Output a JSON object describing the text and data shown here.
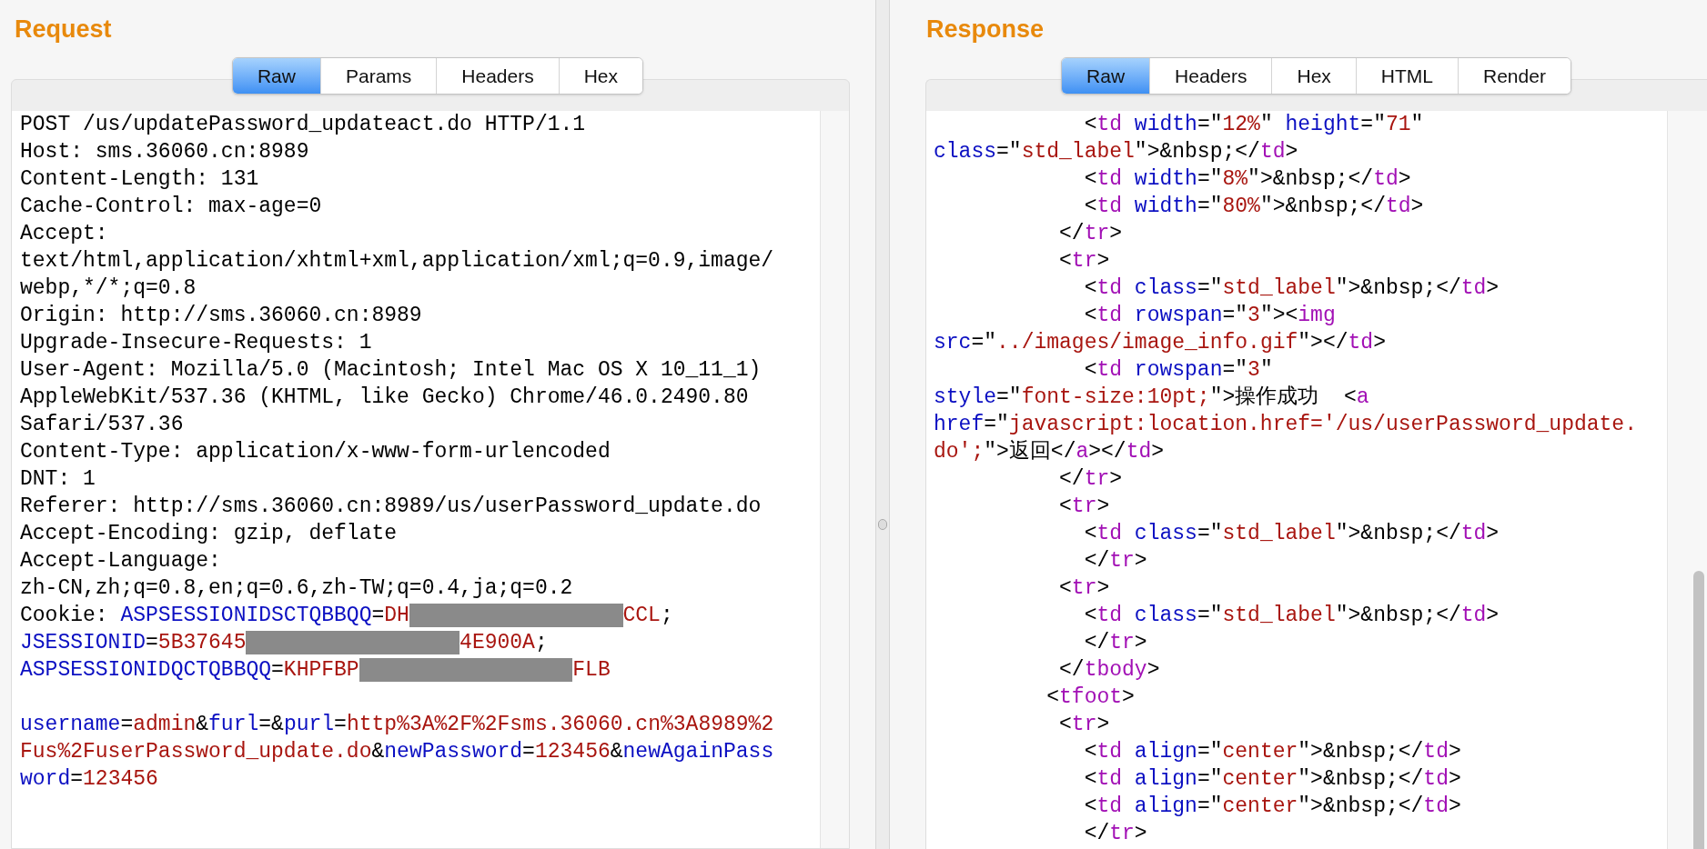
{
  "request": {
    "title": "Request",
    "tabs": [
      {
        "label": "Raw",
        "selected": true
      },
      {
        "label": "Params",
        "selected": false
      },
      {
        "label": "Headers",
        "selected": false
      },
      {
        "label": "Hex",
        "selected": false
      }
    ],
    "headers": [
      [
        {
          "kind": "plain",
          "text": "POST /us/updatePassword_updateact.do HTTP/1.1"
        }
      ],
      [
        {
          "kind": "plain",
          "text": "Host: sms.36060.cn:8989"
        }
      ],
      [
        {
          "kind": "plain",
          "text": "Content-Length: 131"
        }
      ],
      [
        {
          "kind": "plain",
          "text": "Cache-Control: max-age=0"
        }
      ],
      [
        {
          "kind": "plain",
          "text": "Accept:"
        }
      ],
      [
        {
          "kind": "plain",
          "text": "text/html,application/xhtml+xml,application/xml;q=0.9,image/"
        }
      ],
      [
        {
          "kind": "plain",
          "text": "webp,*/*;q=0.8"
        }
      ],
      [
        {
          "kind": "plain",
          "text": "Origin: http://sms.36060.cn:8989"
        }
      ],
      [
        {
          "kind": "plain",
          "text": "Upgrade-Insecure-Requests: 1"
        }
      ],
      [
        {
          "kind": "plain",
          "text": "User-Agent: Mozilla/5.0 (Macintosh; Intel Mac OS X 10_11_1)"
        }
      ],
      [
        {
          "kind": "plain",
          "text": "AppleWebKit/537.36 (KHTML, like Gecko) Chrome/46.0.2490.80"
        }
      ],
      [
        {
          "kind": "plain",
          "text": "Safari/537.36"
        }
      ],
      [
        {
          "kind": "plain",
          "text": "Content-Type: application/x-www-form-urlencoded"
        }
      ],
      [
        {
          "kind": "plain",
          "text": "DNT: 1"
        }
      ],
      [
        {
          "kind": "plain",
          "text": "Referer: http://sms.36060.cn:8989/us/userPassword_update.do"
        }
      ],
      [
        {
          "kind": "plain",
          "text": "Accept-Encoding: gzip, deflate"
        }
      ],
      [
        {
          "kind": "plain",
          "text": "Accept-Language:"
        }
      ],
      [
        {
          "kind": "plain",
          "text": "zh-CN,zh;q=0.8,en;q=0.6,zh-TW;q=0.4,ja;q=0.2"
        }
      ],
      [
        {
          "kind": "plain",
          "text": "Cookie: "
        },
        {
          "kind": "name",
          "text": "ASPSESSIONIDSCTQBBQQ"
        },
        {
          "kind": "plain",
          "text": "="
        },
        {
          "kind": "value",
          "text": "DH"
        },
        {
          "kind": "redacted"
        },
        {
          "kind": "value",
          "text": "CCL"
        },
        {
          "kind": "plain",
          "text": ";"
        }
      ],
      [
        {
          "kind": "name",
          "text": "JSESSIONID"
        },
        {
          "kind": "plain",
          "text": "="
        },
        {
          "kind": "value",
          "text": "5B37645"
        },
        {
          "kind": "redacted"
        },
        {
          "kind": "value",
          "text": "4E900A"
        },
        {
          "kind": "plain",
          "text": ";"
        }
      ],
      [
        {
          "kind": "name",
          "text": "ASPSESSIONIDQCTQBBQQ"
        },
        {
          "kind": "plain",
          "text": "="
        },
        {
          "kind": "value",
          "text": "KHPFBP"
        },
        {
          "kind": "redacted"
        },
        {
          "kind": "value",
          "text": "FLB"
        }
      ]
    ],
    "body": [
      [
        {
          "kind": "name",
          "text": "username"
        },
        {
          "kind": "plain",
          "text": "="
        },
        {
          "kind": "value",
          "text": "admin"
        },
        {
          "kind": "plain",
          "text": "&"
        },
        {
          "kind": "name",
          "text": "furl"
        },
        {
          "kind": "plain",
          "text": "=&"
        },
        {
          "kind": "name",
          "text": "purl"
        },
        {
          "kind": "plain",
          "text": "="
        },
        {
          "kind": "value",
          "text": "http%3A%2F%2Fsms.36060.cn%3A8989%2"
        }
      ],
      [
        {
          "kind": "value",
          "text": "Fus%2FuserPassword_update.do"
        },
        {
          "kind": "plain",
          "text": "&"
        },
        {
          "kind": "name",
          "text": "newPassword"
        },
        {
          "kind": "plain",
          "text": "="
        },
        {
          "kind": "value",
          "text": "123456"
        },
        {
          "kind": "plain",
          "text": "&"
        },
        {
          "kind": "name",
          "text": "newAgainPass"
        }
      ],
      [
        {
          "kind": "name",
          "text": "word"
        },
        {
          "kind": "plain",
          "text": "="
        },
        {
          "kind": "value",
          "text": "123456"
        }
      ]
    ]
  },
  "response": {
    "title": "Response",
    "tabs": [
      {
        "label": "Raw",
        "selected": true
      },
      {
        "label": "Headers",
        "selected": false
      },
      {
        "label": "Hex",
        "selected": false
      },
      {
        "label": "HTML",
        "selected": false
      },
      {
        "label": "Render",
        "selected": false
      }
    ],
    "lines": [
      [
        {
          "kind": "plain",
          "text": "            <"
        },
        {
          "kind": "tag",
          "text": "td"
        },
        {
          "kind": "name",
          "text": " width"
        },
        {
          "kind": "plain",
          "text": "=\""
        },
        {
          "kind": "value",
          "text": "12%"
        },
        {
          "kind": "plain",
          "text": "\" "
        },
        {
          "kind": "name",
          "text": "height"
        },
        {
          "kind": "plain",
          "text": "=\""
        },
        {
          "kind": "value",
          "text": "71"
        },
        {
          "kind": "plain",
          "text": "\""
        }
      ],
      [
        {
          "kind": "name",
          "text": "class"
        },
        {
          "kind": "plain",
          "text": "=\""
        },
        {
          "kind": "value",
          "text": "std_label"
        },
        {
          "kind": "plain",
          "text": "\">&nbsp;</"
        },
        {
          "kind": "tag",
          "text": "td"
        },
        {
          "kind": "plain",
          "text": ">"
        }
      ],
      [
        {
          "kind": "plain",
          "text": "            <"
        },
        {
          "kind": "tag",
          "text": "td"
        },
        {
          "kind": "name",
          "text": " width"
        },
        {
          "kind": "plain",
          "text": "=\""
        },
        {
          "kind": "value",
          "text": "8%"
        },
        {
          "kind": "plain",
          "text": "\">&nbsp;</"
        },
        {
          "kind": "tag",
          "text": "td"
        },
        {
          "kind": "plain",
          "text": ">"
        }
      ],
      [
        {
          "kind": "plain",
          "text": "            <"
        },
        {
          "kind": "tag",
          "text": "td"
        },
        {
          "kind": "name",
          "text": " width"
        },
        {
          "kind": "plain",
          "text": "=\""
        },
        {
          "kind": "value",
          "text": "80%"
        },
        {
          "kind": "plain",
          "text": "\">&nbsp;</"
        },
        {
          "kind": "tag",
          "text": "td"
        },
        {
          "kind": "plain",
          "text": ">"
        }
      ],
      [
        {
          "kind": "plain",
          "text": "          </"
        },
        {
          "kind": "tag",
          "text": "tr"
        },
        {
          "kind": "plain",
          "text": ">"
        }
      ],
      [
        {
          "kind": "plain",
          "text": "          <"
        },
        {
          "kind": "tag",
          "text": "tr"
        },
        {
          "kind": "plain",
          "text": ">"
        }
      ],
      [
        {
          "kind": "plain",
          "text": "            <"
        },
        {
          "kind": "tag",
          "text": "td"
        },
        {
          "kind": "name",
          "text": " class"
        },
        {
          "kind": "plain",
          "text": "=\""
        },
        {
          "kind": "value",
          "text": "std_label"
        },
        {
          "kind": "plain",
          "text": "\">&nbsp;</"
        },
        {
          "kind": "tag",
          "text": "td"
        },
        {
          "kind": "plain",
          "text": ">"
        }
      ],
      [
        {
          "kind": "plain",
          "text": "            <"
        },
        {
          "kind": "tag",
          "text": "td"
        },
        {
          "kind": "name",
          "text": " rowspan"
        },
        {
          "kind": "plain",
          "text": "=\""
        },
        {
          "kind": "value",
          "text": "3"
        },
        {
          "kind": "plain",
          "text": "\"><"
        },
        {
          "kind": "tag",
          "text": "img"
        }
      ],
      [
        {
          "kind": "name",
          "text": "src"
        },
        {
          "kind": "plain",
          "text": "=\""
        },
        {
          "kind": "value",
          "text": "../images/image_info.gif"
        },
        {
          "kind": "plain",
          "text": "\"></"
        },
        {
          "kind": "tag",
          "text": "td"
        },
        {
          "kind": "plain",
          "text": ">"
        }
      ],
      [
        {
          "kind": "plain",
          "text": "            <"
        },
        {
          "kind": "tag",
          "text": "td"
        },
        {
          "kind": "name",
          "text": " rowspan"
        },
        {
          "kind": "plain",
          "text": "=\""
        },
        {
          "kind": "value",
          "text": "3"
        },
        {
          "kind": "plain",
          "text": "\""
        }
      ],
      [
        {
          "kind": "name",
          "text": "style"
        },
        {
          "kind": "plain",
          "text": "=\""
        },
        {
          "kind": "value",
          "text": "font-size:10pt;"
        },
        {
          "kind": "plain",
          "text": "\">操作成功  <"
        },
        {
          "kind": "tag",
          "text": "a"
        }
      ],
      [
        {
          "kind": "name",
          "text": "href"
        },
        {
          "kind": "plain",
          "text": "=\""
        },
        {
          "kind": "value",
          "text": "javascript:location.href='/us/userPassword_update."
        }
      ],
      [
        {
          "kind": "value",
          "text": "do';"
        },
        {
          "kind": "plain",
          "text": "\">返回</"
        },
        {
          "kind": "tag",
          "text": "a"
        },
        {
          "kind": "plain",
          "text": "></"
        },
        {
          "kind": "tag",
          "text": "td"
        },
        {
          "kind": "plain",
          "text": ">"
        }
      ],
      [
        {
          "kind": "plain",
          "text": "          </"
        },
        {
          "kind": "tag",
          "text": "tr"
        },
        {
          "kind": "plain",
          "text": ">"
        }
      ],
      [
        {
          "kind": "plain",
          "text": "          <"
        },
        {
          "kind": "tag",
          "text": "tr"
        },
        {
          "kind": "plain",
          "text": ">"
        }
      ],
      [
        {
          "kind": "plain",
          "text": "            <"
        },
        {
          "kind": "tag",
          "text": "td"
        },
        {
          "kind": "name",
          "text": " class"
        },
        {
          "kind": "plain",
          "text": "=\""
        },
        {
          "kind": "value",
          "text": "std_label"
        },
        {
          "kind": "plain",
          "text": "\">&nbsp;</"
        },
        {
          "kind": "tag",
          "text": "td"
        },
        {
          "kind": "plain",
          "text": ">"
        }
      ],
      [
        {
          "kind": "plain",
          "text": "            </"
        },
        {
          "kind": "tag",
          "text": "tr"
        },
        {
          "kind": "plain",
          "text": ">"
        }
      ],
      [
        {
          "kind": "plain",
          "text": "          <"
        },
        {
          "kind": "tag",
          "text": "tr"
        },
        {
          "kind": "plain",
          "text": ">"
        }
      ],
      [
        {
          "kind": "plain",
          "text": "            <"
        },
        {
          "kind": "tag",
          "text": "td"
        },
        {
          "kind": "name",
          "text": " class"
        },
        {
          "kind": "plain",
          "text": "=\""
        },
        {
          "kind": "value",
          "text": "std_label"
        },
        {
          "kind": "plain",
          "text": "\">&nbsp;</"
        },
        {
          "kind": "tag",
          "text": "td"
        },
        {
          "kind": "plain",
          "text": ">"
        }
      ],
      [
        {
          "kind": "plain",
          "text": "            </"
        },
        {
          "kind": "tag",
          "text": "tr"
        },
        {
          "kind": "plain",
          "text": ">"
        }
      ],
      [
        {
          "kind": "plain",
          "text": "          </"
        },
        {
          "kind": "tag",
          "text": "tbody"
        },
        {
          "kind": "plain",
          "text": ">"
        }
      ],
      [
        {
          "kind": "plain",
          "text": "         <"
        },
        {
          "kind": "tag",
          "text": "tfoot"
        },
        {
          "kind": "plain",
          "text": ">"
        }
      ],
      [
        {
          "kind": "plain",
          "text": "          <"
        },
        {
          "kind": "tag",
          "text": "tr"
        },
        {
          "kind": "plain",
          "text": ">"
        }
      ],
      [
        {
          "kind": "plain",
          "text": "            <"
        },
        {
          "kind": "tag",
          "text": "td"
        },
        {
          "kind": "name",
          "text": " align"
        },
        {
          "kind": "plain",
          "text": "=\""
        },
        {
          "kind": "value",
          "text": "center"
        },
        {
          "kind": "plain",
          "text": "\">&nbsp;</"
        },
        {
          "kind": "tag",
          "text": "td"
        },
        {
          "kind": "plain",
          "text": ">"
        }
      ],
      [
        {
          "kind": "plain",
          "text": "            <"
        },
        {
          "kind": "tag",
          "text": "td"
        },
        {
          "kind": "name",
          "text": " align"
        },
        {
          "kind": "plain",
          "text": "=\""
        },
        {
          "kind": "value",
          "text": "center"
        },
        {
          "kind": "plain",
          "text": "\">&nbsp;</"
        },
        {
          "kind": "tag",
          "text": "td"
        },
        {
          "kind": "plain",
          "text": ">"
        }
      ],
      [
        {
          "kind": "plain",
          "text": "            <"
        },
        {
          "kind": "tag",
          "text": "td"
        },
        {
          "kind": "name",
          "text": " align"
        },
        {
          "kind": "plain",
          "text": "=\""
        },
        {
          "kind": "value",
          "text": "center"
        },
        {
          "kind": "plain",
          "text": "\">&nbsp;</"
        },
        {
          "kind": "tag",
          "text": "td"
        },
        {
          "kind": "plain",
          "text": ">"
        }
      ],
      [
        {
          "kind": "plain",
          "text": "            </"
        },
        {
          "kind": "tag",
          "text": "tr"
        },
        {
          "kind": "plain",
          "text": ">"
        }
      ]
    ]
  }
}
